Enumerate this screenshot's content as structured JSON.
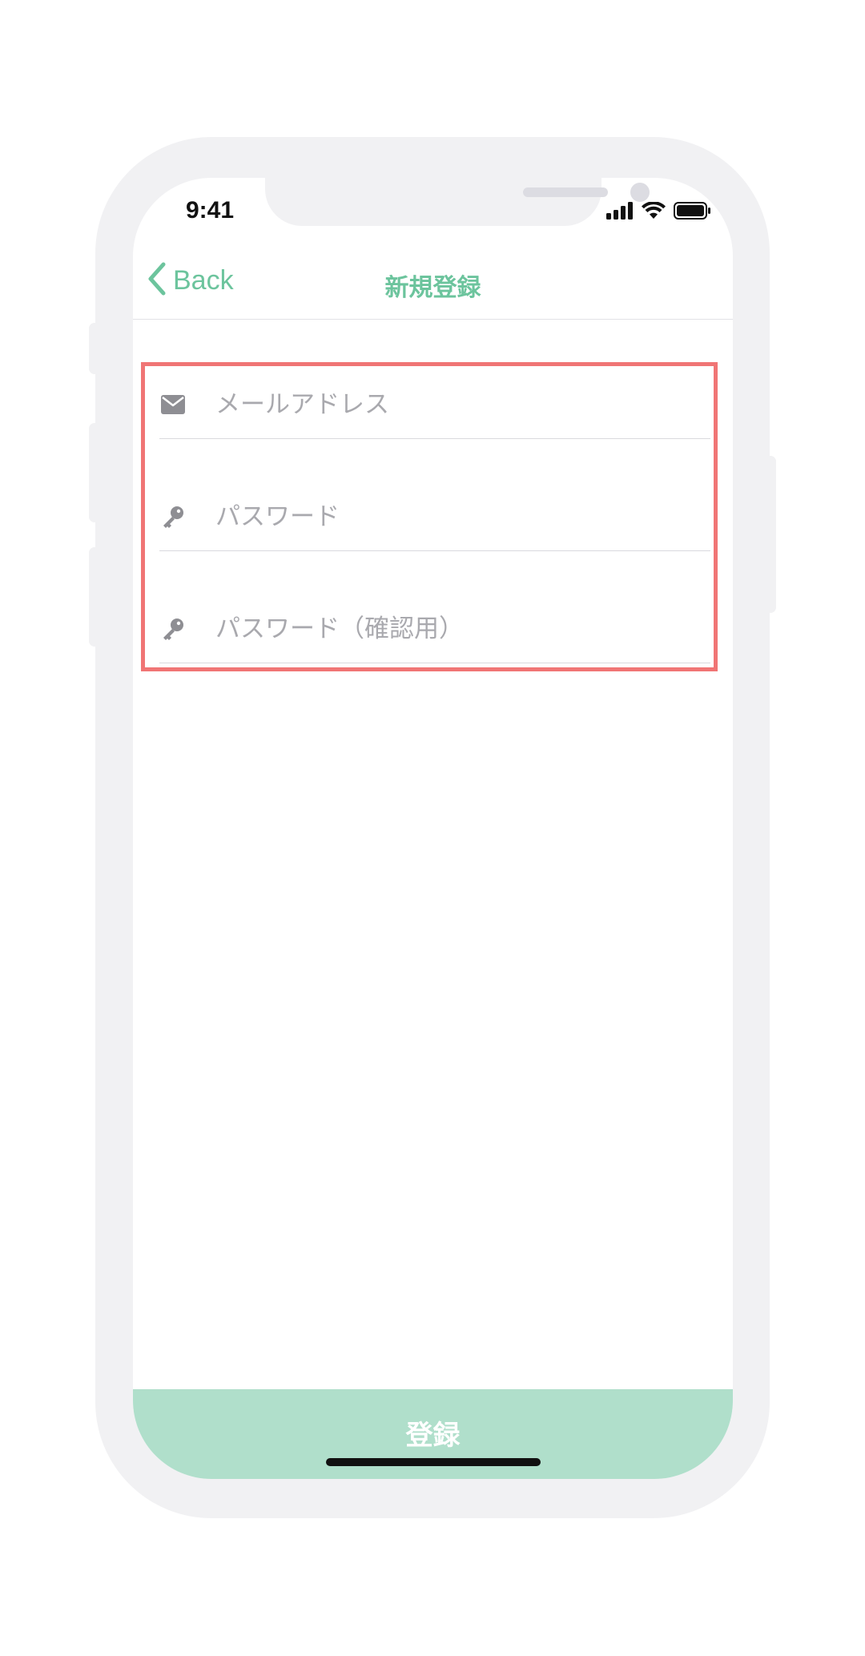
{
  "status_bar": {
    "time": "9:41"
  },
  "nav": {
    "back_label": "Back",
    "title": "新規登録"
  },
  "form": {
    "email_placeholder": "メールアドレス",
    "password_placeholder": "パスワード",
    "password_confirm_placeholder": "パスワード（確認用）"
  },
  "submit": {
    "label": "登録"
  },
  "colors": {
    "accent": "#6cc49d",
    "button_bg": "#b0dfcb",
    "highlight_border": "#f07575",
    "placeholder": "#a9a9ae",
    "icon": "#8e8e93"
  },
  "icons": {
    "email": "envelope-icon",
    "password": "key-icon",
    "back": "chevron-left-icon"
  }
}
